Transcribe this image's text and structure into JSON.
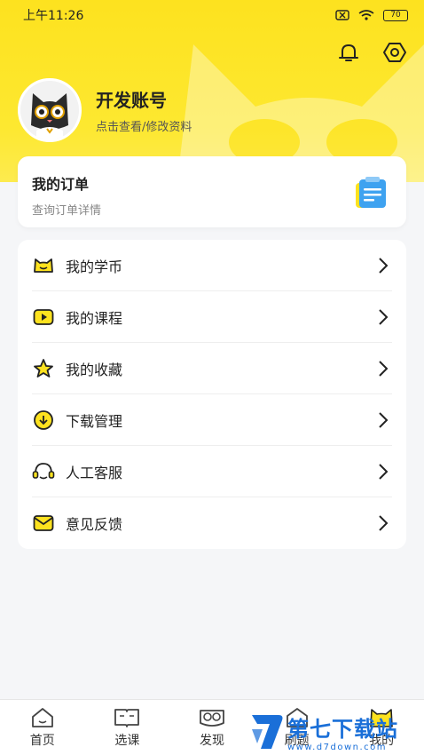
{
  "status_bar": {
    "time": "上午11:26",
    "battery": "70"
  },
  "profile": {
    "name": "开发账号",
    "subtitle": "点击查看/修改资料"
  },
  "order": {
    "title": "我的订单",
    "subtitle": "查询订单详情"
  },
  "menu": [
    {
      "label": "我的学币",
      "icon": "coin-cat-icon"
    },
    {
      "label": "我的课程",
      "icon": "play-icon"
    },
    {
      "label": "我的收藏",
      "icon": "star-icon"
    },
    {
      "label": "下载管理",
      "icon": "download-icon"
    },
    {
      "label": "人工客服",
      "icon": "headset-icon"
    },
    {
      "label": "意见反馈",
      "icon": "mail-icon"
    }
  ],
  "tabs": [
    {
      "label": "首页",
      "icon": "home-icon"
    },
    {
      "label": "选课",
      "icon": "book-icon"
    },
    {
      "label": "发现",
      "icon": "glasses-icon"
    },
    {
      "label": "刷题",
      "icon": "practice-icon"
    },
    {
      "label": "我的",
      "icon": "profile-cat-icon",
      "active": true
    }
  ],
  "watermark": {
    "brand": "第七下载站",
    "url": "www.d7down.com"
  },
  "colors": {
    "accent": "#fde21f",
    "watermark": "#1a6fd8"
  }
}
